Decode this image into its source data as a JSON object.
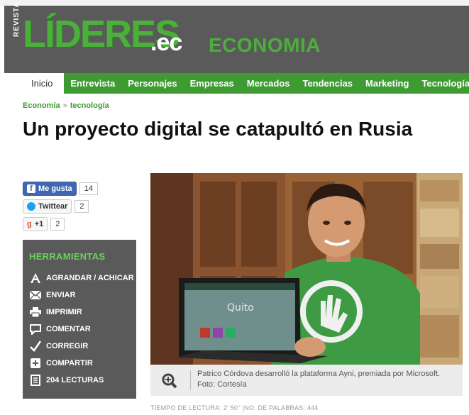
{
  "header": {
    "revista": "REVISTA",
    "logo": "LÍDERES",
    "logo_suffix": ".ec",
    "section": "ECONOMIA"
  },
  "nav": {
    "items": [
      {
        "label": "Inicio"
      },
      {
        "label": "Entrevista"
      },
      {
        "label": "Personajes"
      },
      {
        "label": "Empresas"
      },
      {
        "label": "Mercados"
      },
      {
        "label": "Tendencias"
      },
      {
        "label": "Marketing"
      },
      {
        "label": "Tecnología"
      }
    ]
  },
  "breadcrumb": {
    "items": [
      "Economía",
      "tecnología"
    ],
    "separator": "»"
  },
  "article": {
    "title": "Un proyecto digital se catapultó en Rusia",
    "caption": "Patrico Córdova desarrolló la plataforma Ayni, premiada por Microsoft. Foto: Cortesía",
    "reading_time": "TIEMPO DE LECTURA: 2' 50''",
    "word_count": "NO. DE PALABRAS: 444",
    "laptop_screen_text": "Quito"
  },
  "social": {
    "like_label": "Me gusta",
    "like_count": "14",
    "tweet_label": "Twittear",
    "tweet_count": "2",
    "gplus_label": "+1",
    "gplus_count": "2"
  },
  "tools": {
    "title": "HERRAMIENTAS",
    "items": [
      {
        "label": "AGRANDAR / ACHICAR",
        "icon": "text-size-icon"
      },
      {
        "label": "ENVIAR",
        "icon": "mail-icon"
      },
      {
        "label": "IMPRIMIR",
        "icon": "print-icon"
      },
      {
        "label": "COMENTAR",
        "icon": "comment-icon"
      },
      {
        "label": "CORREGIR",
        "icon": "check-icon"
      },
      {
        "label": "COMPARTIR",
        "icon": "share-icon"
      },
      {
        "label": "204 LECTURAS",
        "icon": "document-icon"
      }
    ]
  },
  "colors": {
    "brand_green": "#3d9b32",
    "logo_green": "#4caf3c",
    "header_gray": "#5a5a5a",
    "facebook_blue": "#4267b2"
  }
}
